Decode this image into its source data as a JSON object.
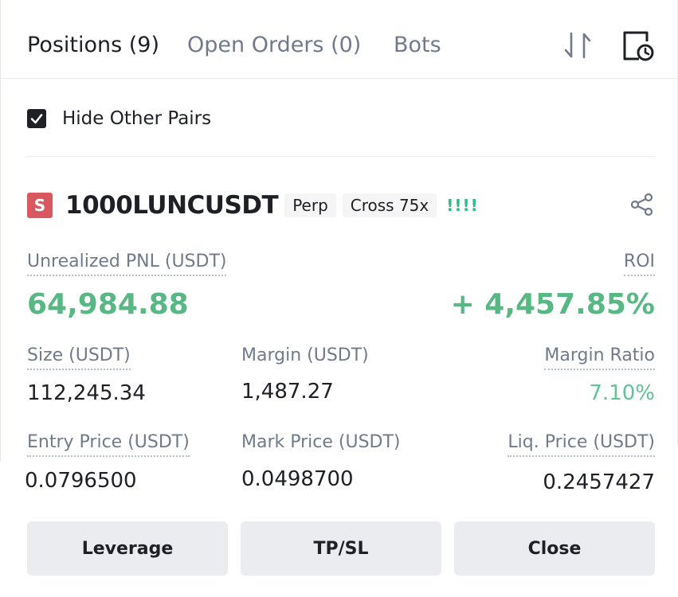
{
  "tabs": [
    {
      "label": "Positions (9)",
      "active": true
    },
    {
      "label": "Open Orders (0)",
      "active": false
    },
    {
      "label": "Bots",
      "active": false
    }
  ],
  "icons": {
    "sort": "sort-arrows-icon",
    "history": "history-clock-icon",
    "share": "share-icon"
  },
  "filter": {
    "hide_other_pairs_label": "Hide Other Pairs",
    "checked": true
  },
  "position": {
    "side_badge": "S",
    "symbol": "1000LUNCUSDT",
    "type_tag": "Perp",
    "margin_tag": "Cross 75x",
    "risk_indicator": "!!!!",
    "unrealized_pnl_label": "Unrealized PNL (USDT)",
    "unrealized_pnl_value": "64,984.88",
    "roi_label": "ROI",
    "roi_value": "+ 4,457.85%",
    "size_label": "Size (USDT)",
    "size_value": "112,245.34",
    "margin_label": "Margin (USDT)",
    "margin_value": "1,487.27",
    "margin_ratio_label": "Margin Ratio",
    "margin_ratio_value": "7.10%",
    "entry_price_label": "Entry Price (USDT)",
    "entry_price_value": "0.0796500",
    "mark_price_label": "Mark Price (USDT)",
    "mark_price_value": "0.0498700",
    "liq_price_label": "Liq. Price (USDT)",
    "liq_price_value": "0.2457427"
  },
  "actions": {
    "leverage": "Leverage",
    "tpsl": "TP/SL",
    "close": "Close"
  },
  "colors": {
    "profit_green": "#58b884",
    "sell_red": "#d9575e",
    "text_primary": "#1e2026",
    "text_secondary": "#707a8a",
    "button_bg": "#eaecef"
  }
}
